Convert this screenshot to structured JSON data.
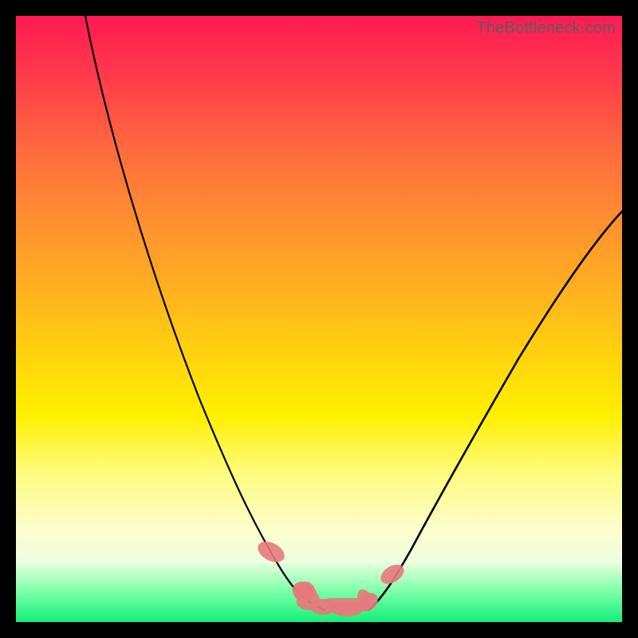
{
  "watermark": "TheBottleneck.com",
  "colors": {
    "gradient_top": "#ff1a53",
    "gradient_bottom": "#13f07a",
    "curve": "#000000",
    "blob": "#e77a7c",
    "frame": "#000000"
  },
  "chart_data": {
    "type": "line",
    "title": "",
    "xlabel": "",
    "ylabel": "",
    "xlim": [
      0,
      100
    ],
    "ylim": [
      0,
      110
    ],
    "series": [
      {
        "name": "left-curve",
        "x": [
          11,
          15,
          20,
          25,
          30,
          35,
          40,
          42,
          44,
          46,
          48,
          50
        ],
        "values": [
          110,
          92,
          74,
          58,
          44,
          32,
          20,
          14,
          10,
          6,
          3,
          2
        ]
      },
      {
        "name": "right-curve",
        "x": [
          58,
          60,
          63,
          67,
          72,
          78,
          85,
          92,
          100
        ],
        "values": [
          2,
          4,
          8,
          14,
          24,
          36,
          50,
          62,
          72
        ]
      }
    ],
    "highlight_regions": [
      {
        "name": "trough-blob",
        "x_range": [
          46,
          60
        ],
        "y_range": [
          0,
          5
        ]
      },
      {
        "name": "left-small-blob",
        "x_range": [
          40,
          43
        ],
        "y_range": [
          10,
          15
        ]
      },
      {
        "name": "right-small-blob",
        "x_range": [
          61,
          64
        ],
        "y_range": [
          6,
          10
        ]
      }
    ]
  }
}
